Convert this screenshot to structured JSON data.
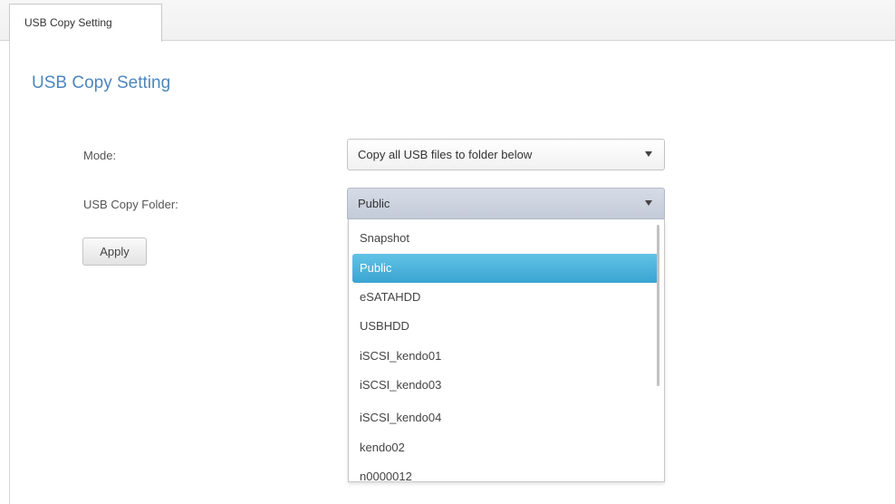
{
  "tabs": [
    {
      "label": "USB Copy Setting"
    }
  ],
  "section_title": "USB Copy Setting",
  "form": {
    "mode": {
      "label": "Mode:",
      "value": "Copy all USB files to folder below"
    },
    "folder": {
      "label": "USB Copy Folder:",
      "value": "Public"
    },
    "apply_label": "Apply"
  },
  "dropdown": {
    "selected": "Public",
    "options": [
      "Snapshot",
      "Public",
      "eSATAHDD",
      "USBHDD",
      "iSCSI_kendo01",
      "iSCSI_kendo03",
      "iSCSI_kendo04",
      "kendo02",
      "n0000012"
    ]
  },
  "colors": {
    "title_blue": "#4d86bd",
    "selected_option_bg": "#3aa4d2"
  }
}
